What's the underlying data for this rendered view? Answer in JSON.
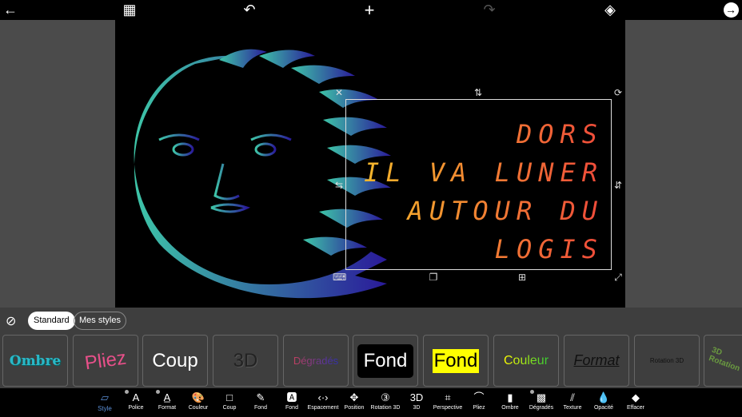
{
  "topbar": {
    "icons": [
      "back-arrow-icon",
      "grid-icon",
      "undo-icon",
      "add-icon",
      "redo-icon",
      "layers-icon",
      "next-arrow-icon"
    ]
  },
  "canvas": {
    "text_lines": [
      "DORS",
      "IL VA LUNER",
      "AUTOUR DU",
      "LOGIS"
    ],
    "colors": {
      "gradient_start": "#f5c02a",
      "gradient_end": "#ef4a3a",
      "sun_start": "#3ec6a8",
      "sun_end": "#2a1a9a"
    }
  },
  "styles_row": {
    "standard": "Standard",
    "mes_styles": "Mes styles"
  },
  "style_cards": [
    "Ombre",
    "Pliez",
    "Coup",
    "3D",
    "Dégradés",
    "Fond",
    "Fond",
    "Couleur",
    "Format",
    "Rotation 3D",
    "3D Rotation"
  ],
  "tools": [
    {
      "label": "Style",
      "icon": "style-icon",
      "active": true
    },
    {
      "label": "Police",
      "icon": "font-icon",
      "badge": true
    },
    {
      "label": "Format",
      "icon": "format-icon",
      "badge": true
    },
    {
      "label": "Couleur",
      "icon": "palette-icon"
    },
    {
      "label": "Coup",
      "icon": "stroke-icon"
    },
    {
      "label": "Fond",
      "icon": "brush-icon"
    },
    {
      "label": "Fond",
      "icon": "background-icon"
    },
    {
      "label": "Espacement",
      "icon": "spacing-icon"
    },
    {
      "label": "Position",
      "icon": "move-icon"
    },
    {
      "label": "Rotation 3D",
      "icon": "rotate-3d-icon"
    },
    {
      "label": "3D",
      "icon": "3d-icon"
    },
    {
      "label": "Perspective",
      "icon": "perspective-icon"
    },
    {
      "label": "Pliez",
      "icon": "curve-icon"
    },
    {
      "label": "Ombre",
      "icon": "shadow-icon"
    },
    {
      "label": "Dégradés",
      "icon": "gradient-icon",
      "badge": true
    },
    {
      "label": "Texture",
      "icon": "texture-icon"
    },
    {
      "label": "Opacité",
      "icon": "opacity-icon"
    },
    {
      "label": "Effacer",
      "icon": "eraser-icon"
    }
  ],
  "accent": "#5b8fd6"
}
